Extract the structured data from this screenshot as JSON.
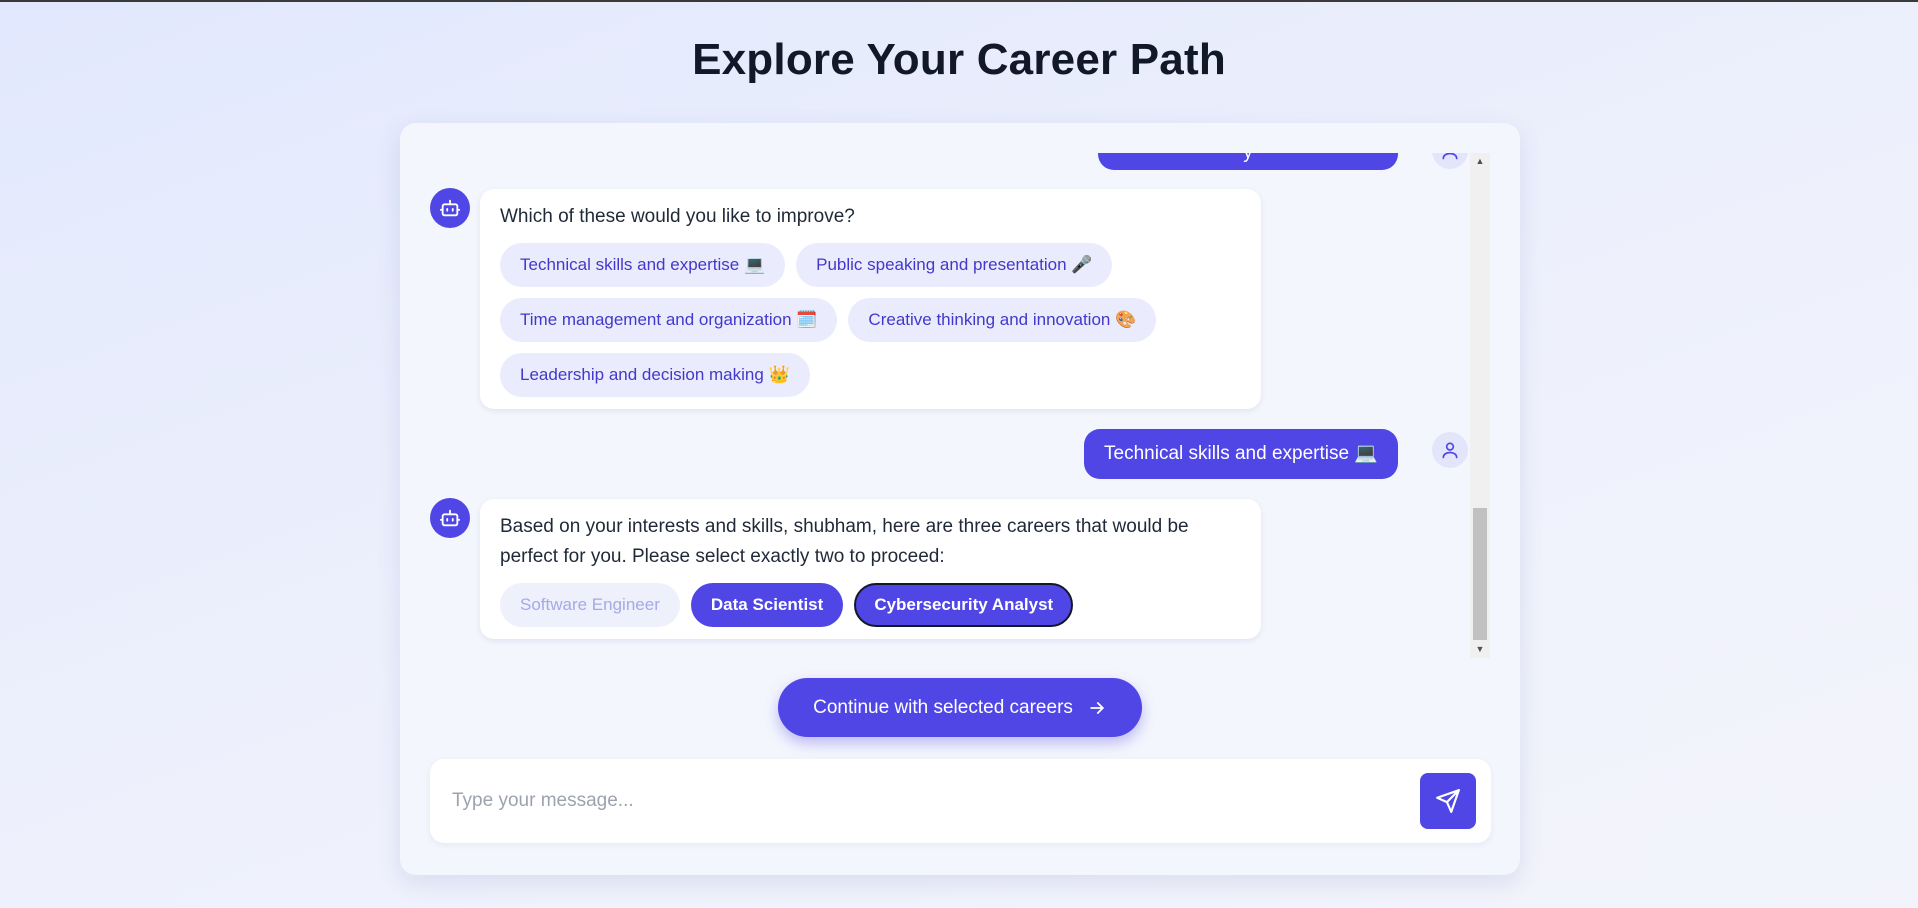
{
  "page": {
    "title": "Explore Your Career Path"
  },
  "messages": {
    "partial_user_text": "y",
    "bot1": {
      "text": "Which of these would you like to improve?",
      "options": [
        "Technical skills and expertise 💻",
        "Public speaking and presentation 🎤",
        "Time management and organization 🗓️",
        "Creative thinking and innovation 🎨",
        "Leadership and decision making 👑"
      ]
    },
    "user1": {
      "text": "Technical skills and expertise 💻"
    },
    "bot2": {
      "text": "Based on your interests and skills, shubham, here are three careers that would be perfect for you. Please select exactly two to proceed:",
      "careers": [
        {
          "label": "Software Engineer",
          "state": "disabled"
        },
        {
          "label": "Data Scientist",
          "state": "selected"
        },
        {
          "label": "Cybersecurity Analyst",
          "state": "selected"
        }
      ]
    }
  },
  "continue_button": {
    "label": "Continue with selected careers"
  },
  "composer": {
    "placeholder": "Type your message...",
    "value": ""
  },
  "icons": {
    "bot_avatar": "robot-icon",
    "user_avatar": "user-icon",
    "continue": "arrow-right-icon",
    "send": "send-icon"
  },
  "colors": {
    "accent": "#4f46e5",
    "chip_bg": "#eaecfd",
    "chip_text": "#4338ca",
    "title": "#111827"
  }
}
